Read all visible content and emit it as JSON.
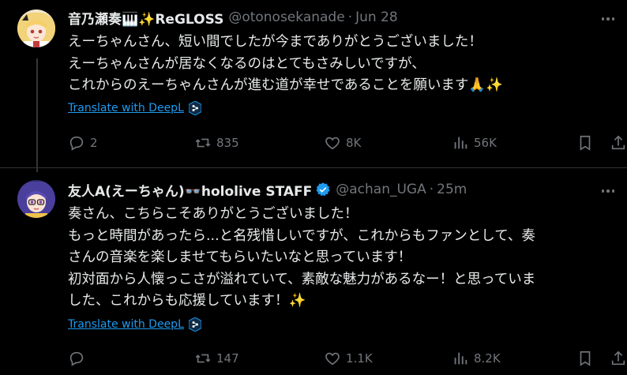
{
  "tweets": [
    {
      "name": "音乃瀬奏🎹✨ReGLOSS",
      "handle": "@otonosekanade",
      "time": "Jun 28",
      "lines": [
        "えーちゃんさん、短い間でしたが今までありがとうございました！",
        "えーちゃんさんが居なくなるのはとてもさみしいですが、",
        "これからのえーちゃんさんが進む道が幸せであることを願います🙏✨"
      ],
      "translate": "Translate with DeepL",
      "replies": "2",
      "retweets": "835",
      "likes": "8K",
      "views": "56K"
    },
    {
      "name": "友人A(えーちゃん)👓hololive STAFF",
      "handle": "@achan_UGA",
      "time": "25m",
      "lines": [
        "奏さん、こちらこそありがとうございました！",
        "もっと時間があったら...と名残惜しいですが、これからもファンとして、奏",
        "さんの音楽を楽しませてもらいたいなと思っています！",
        "初対面から人懐っこさが溢れていて、素敵な魅力があるなー！と思っていま",
        "した、これからも応援しています！✨"
      ],
      "translate": "Translate with DeepL",
      "replies": "",
      "retweets": "147",
      "likes": "1.1K",
      "views": "8.2K"
    }
  ],
  "colors": {
    "background": "#000000",
    "text": "#e7e9ea",
    "muted": "#71767b",
    "link": "#1d9bf0",
    "verified": "#1d9bf0"
  }
}
